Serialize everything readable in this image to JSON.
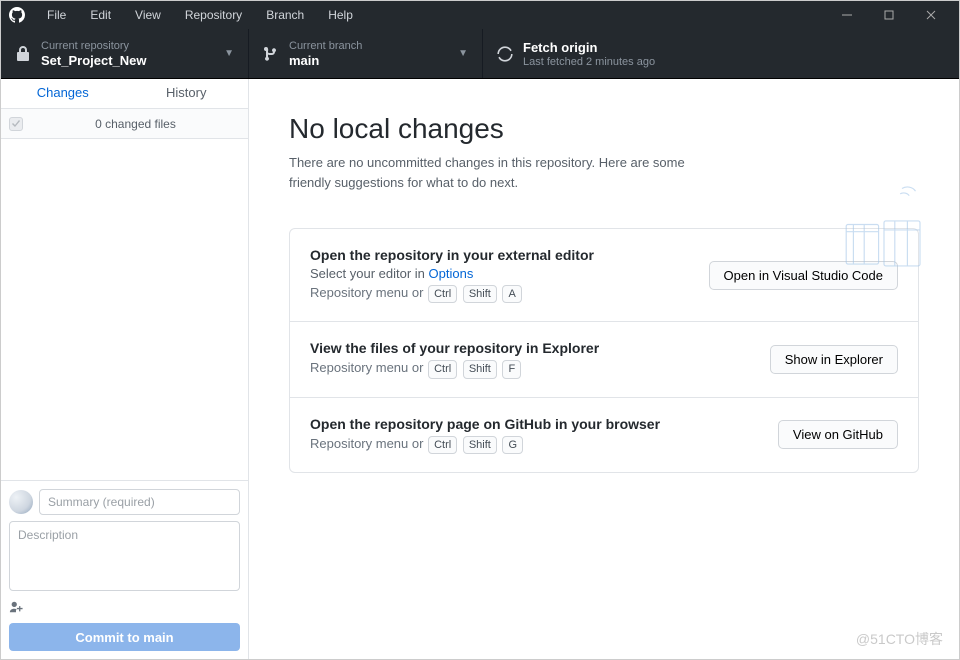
{
  "titlebar": {
    "menu": [
      "File",
      "Edit",
      "View",
      "Repository",
      "Branch",
      "Help"
    ]
  },
  "toolbar": {
    "repo": {
      "label": "Current repository",
      "value": "Set_Project_New"
    },
    "branch": {
      "label": "Current branch",
      "value": "main"
    },
    "fetch": {
      "label": "Fetch origin",
      "sub": "Last fetched 2 minutes ago"
    }
  },
  "sidebar": {
    "tabs": {
      "changes": "Changes",
      "history": "History"
    },
    "changes_header": "0 changed files",
    "commit": {
      "summary_placeholder": "Summary (required)",
      "description_placeholder": "Description",
      "button_prefix": "Commit to ",
      "button_branch": "main"
    }
  },
  "main": {
    "title": "No local changes",
    "subtitle": "There are no uncommitted changes in this repository. Here are some friendly suggestions for what to do next.",
    "cards": [
      {
        "title": "Open the repository in your external editor",
        "sub_prefix": "Select your editor in ",
        "sub_link": "Options",
        "hint_prefix": "Repository menu or",
        "keys": [
          "Ctrl",
          "Shift",
          "A"
        ],
        "button": "Open in Visual Studio Code"
      },
      {
        "title": "View the files of your repository in Explorer",
        "hint_prefix": "Repository menu or",
        "keys": [
          "Ctrl",
          "Shift",
          "F"
        ],
        "button": "Show in Explorer"
      },
      {
        "title": "Open the repository page on GitHub in your browser",
        "hint_prefix": "Repository menu or",
        "keys": [
          "Ctrl",
          "Shift",
          "G"
        ],
        "button": "View on GitHub"
      }
    ]
  },
  "watermark": "@51CTO博客"
}
